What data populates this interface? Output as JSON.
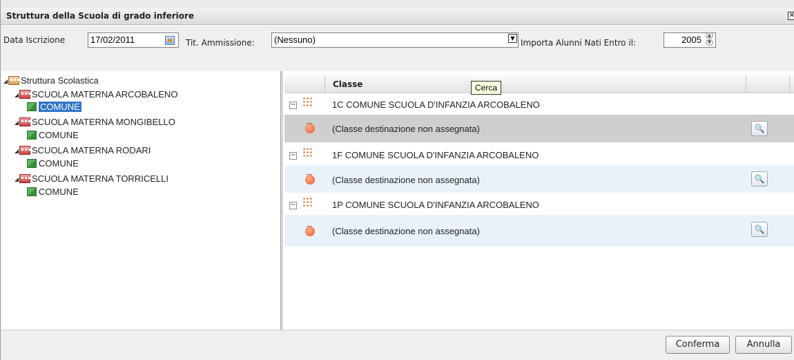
{
  "window": {
    "title": "Struttura della Scuola di grado inferiore",
    "close_label": "✕"
  },
  "toolbar": {
    "data_iscrizione_label": "Data Iscrizione",
    "data_iscrizione_value": "17/02/2011",
    "tit_ammissione_label": "Tit. Ammissione:",
    "tit_ammissione_value": "(Nessuno)",
    "importa_label": "Importa Alunni Nati Entro il:",
    "importa_value": "2005"
  },
  "tree": {
    "root": "Struttura Scolastica",
    "schools": [
      {
        "name": "SCUOLA MATERNA ARCOBALENO",
        "child": "COMUNE"
      },
      {
        "name": "SCUOLA MATERNA MONGIBELLO",
        "child": "COMUNE"
      },
      {
        "name": "SCUOLA MATERNA RODARI",
        "child": "COMUNE"
      },
      {
        "name": "SCUOLA MATERNA TORRICELLI",
        "child": "COMUNE"
      }
    ]
  },
  "grid": {
    "column_header": "Classe",
    "groups": [
      {
        "title": "1C COMUNE SCUOLA D'INFANZIA ARCOBALENO",
        "row": "(Classe destinazione non assegnata)"
      },
      {
        "title": "1F COMUNE SCUOLA D'INFANZIA ARCOBALENO",
        "row": "(Classe destinazione non assegnata)"
      },
      {
        "title": "1P COMUNE SCUOLA D'INFANZIA ARCOBALENO",
        "row": "(Classe destinazione non assegnata)"
      }
    ],
    "tooltip": "Cerca"
  },
  "footer": {
    "conferma_label": "Conferma",
    "annulla_label": "Annulla"
  }
}
